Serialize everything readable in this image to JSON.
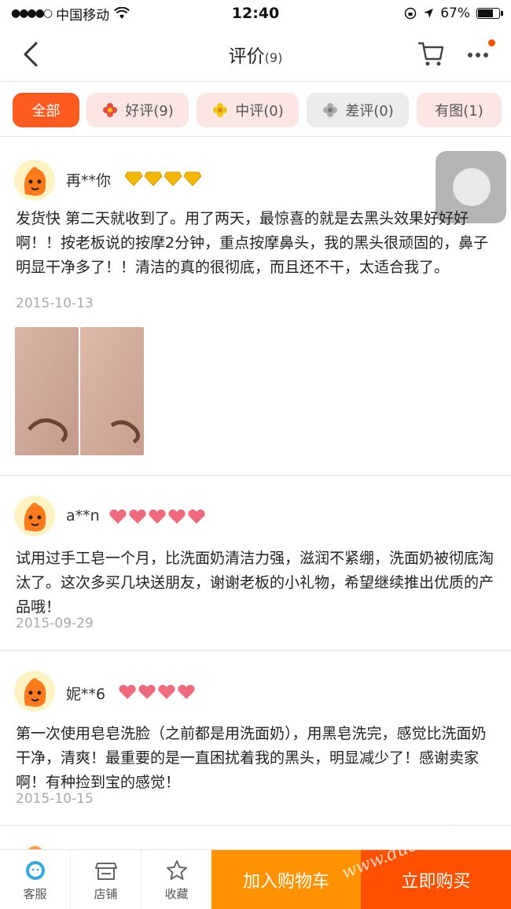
{
  "status_bar": {
    "carrier": "中国移动",
    "time": "12:40",
    "battery": "67%",
    "signal_dots": "●●●●○"
  },
  "header": {
    "title": "评价",
    "count": "(9)"
  },
  "filters": [
    {
      "label": "全部"
    },
    {
      "label": "好评(9)"
    },
    {
      "label": "中评(0)"
    },
    {
      "label": "差评(0)"
    },
    {
      "label": "有图(1)"
    }
  ],
  "reviews": [
    {
      "user": "再**你",
      "badge": "diamond-gold",
      "badge_count": 4,
      "text": "发货快 第二天就收到了。用了两天，最惊喜的就是去黑头效果好好好啊！！按老板说的按摩2分钟，重点按摩鼻头，我的黑头很顽固的，鼻子明显干净多了！！清洁的真的很彻底，而且还不干，太适合我了。",
      "date": "2015-10-13"
    },
    {
      "user": "a**n",
      "badge": "heart-red",
      "badge_count": 5,
      "text": "试用过手工皂一个月，比洗面奶清洁力强，滋润不紧绷，洗面奶被彻底淘汰了。这次多买几块送朋友，谢谢老板的小礼物，希望继续推出优质的产品哦！",
      "date": "2015-09-29"
    },
    {
      "user": "妮**6",
      "badge": "heart-red",
      "badge_count": 4,
      "text": "第一次使用皂皂洗脸（之前都是用洗面奶），用黑皂洗完，感觉比洗面奶干净，清爽！最重要的是一直困扰着我的黑头，明显减少了！感谢卖家啊！有种捡到宝的感觉！",
      "date": "2015-10-15"
    }
  ],
  "bottom_bar": {
    "service": "客服",
    "shop": "店铺",
    "favorite": "收藏",
    "add_to_cart": "加入购物车",
    "buy_now": "立即购买"
  },
  "watermark": "www.duchang",
  "colors": {
    "accent": "#ff5000",
    "cart_button": "#ff9200",
    "active_chip": "#ff5a1f"
  }
}
